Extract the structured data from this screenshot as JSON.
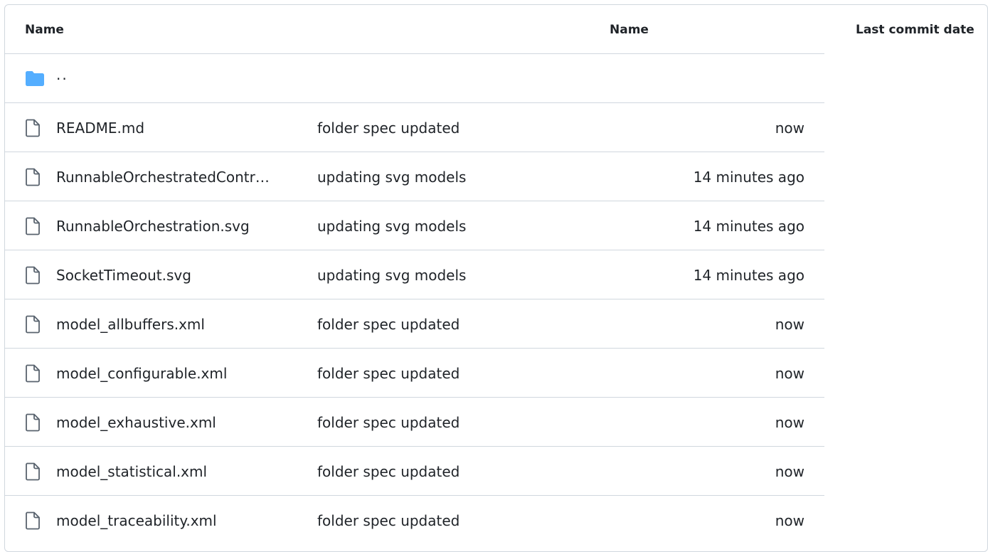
{
  "header": {
    "name_label": "Name",
    "message_label": "Name",
    "date_label": "Last commit date"
  },
  "parent_row": {
    "label": "..",
    "icon": "folder-icon",
    "icon_color": "#54aeff"
  },
  "files": [
    {
      "name": "README.md",
      "message": "folder spec updated",
      "date": "now",
      "icon": "file-icon"
    },
    {
      "name": "RunnableOrchestratedContr…",
      "message": "updating svg models",
      "date": "14 minutes ago",
      "icon": "file-icon"
    },
    {
      "name": "RunnableOrchestration.svg",
      "message": "updating svg models",
      "date": "14 minutes ago",
      "icon": "file-icon"
    },
    {
      "name": "SocketTimeout.svg",
      "message": "updating svg models",
      "date": "14 minutes ago",
      "icon": "file-icon"
    },
    {
      "name": "model_allbuffers.xml",
      "message": "folder spec updated",
      "date": "now",
      "icon": "file-icon"
    },
    {
      "name": "model_configurable.xml",
      "message": "folder spec updated",
      "date": "now",
      "icon": "file-icon"
    },
    {
      "name": "model_exhaustive.xml",
      "message": "folder spec updated",
      "date": "now",
      "icon": "file-icon"
    },
    {
      "name": "model_statistical.xml",
      "message": "folder spec updated",
      "date": "now",
      "icon": "file-icon"
    },
    {
      "name": "model_traceability.xml",
      "message": "folder spec updated",
      "date": "now",
      "icon": "file-icon"
    }
  ],
  "colors": {
    "border": "#d0d7de",
    "text": "#1f2328",
    "file_icon": "#59636e"
  }
}
